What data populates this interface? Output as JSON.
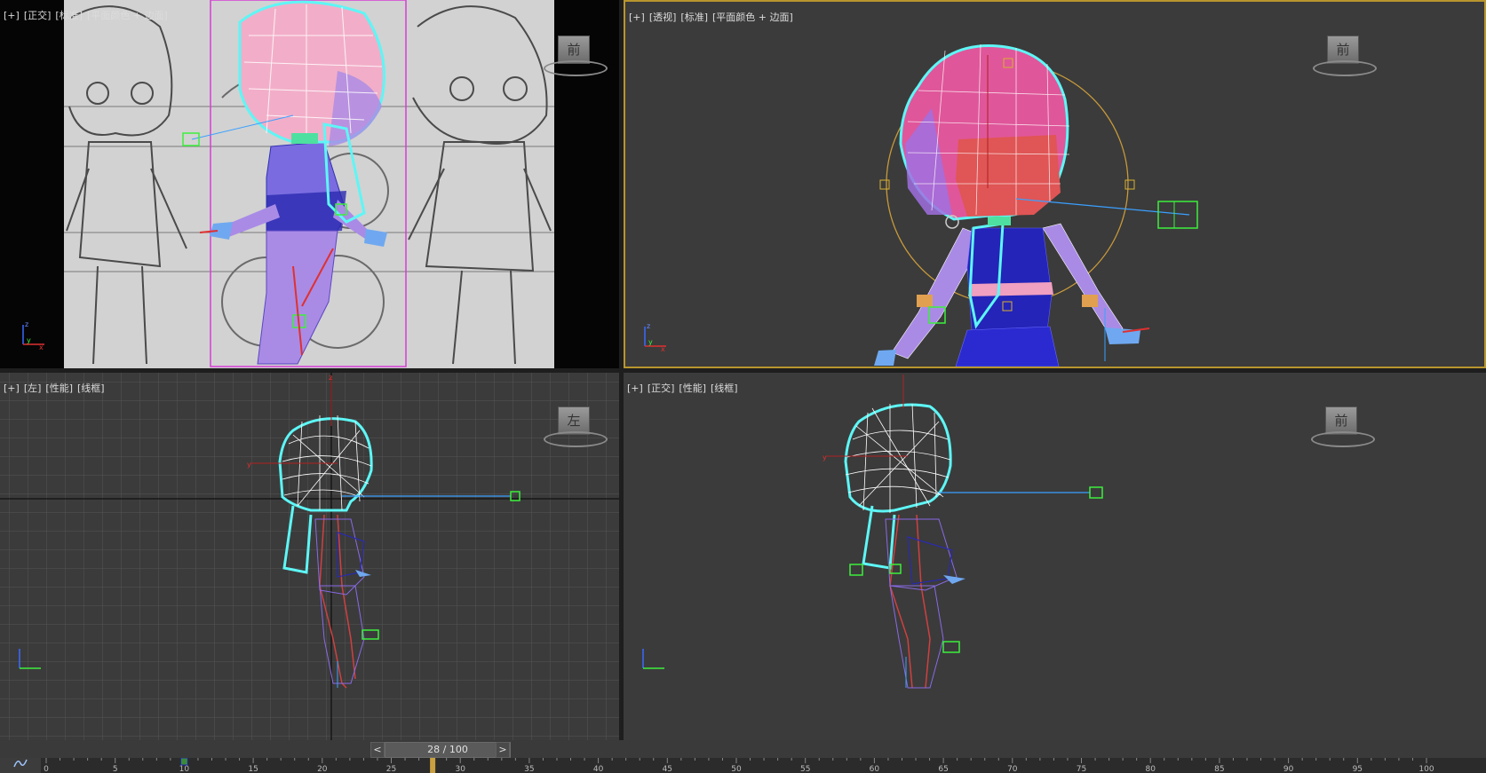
{
  "viewports": {
    "top_left": {
      "label": [
        "[+]",
        "[正交]",
        "[标准]",
        "[平面颜色 + 边面]"
      ],
      "cube": "前"
    },
    "top_right": {
      "label": [
        "[+]",
        "[透视]",
        "[标准]",
        "[平面颜色 + 边面]"
      ],
      "cube": "前"
    },
    "bottom_left": {
      "label": [
        "[+]",
        "[左]",
        "[性能]",
        "[线框]"
      ],
      "cube": "左"
    },
    "bottom_right": {
      "label": [
        "[+]",
        "[正交]",
        "[性能]",
        "[线框]"
      ],
      "cube": "前"
    }
  },
  "frame_slider": {
    "text": "28 / 100",
    "prev": "<",
    "next": ">",
    "current": 28,
    "total": 100
  },
  "timeline": {
    "ticks": [
      0,
      5,
      10,
      15,
      20,
      25,
      30,
      35,
      40,
      45,
      50,
      55,
      60,
      65,
      70,
      75,
      80,
      85,
      90,
      95,
      100
    ],
    "current": 28,
    "key": 10
  },
  "colors": {
    "selection_cyan": "#5ef6f6",
    "hair_pink": "#e0569a",
    "dress_blue": "#2222aa",
    "skin_purple": "#a98be6",
    "active_border": "#b8962e"
  }
}
